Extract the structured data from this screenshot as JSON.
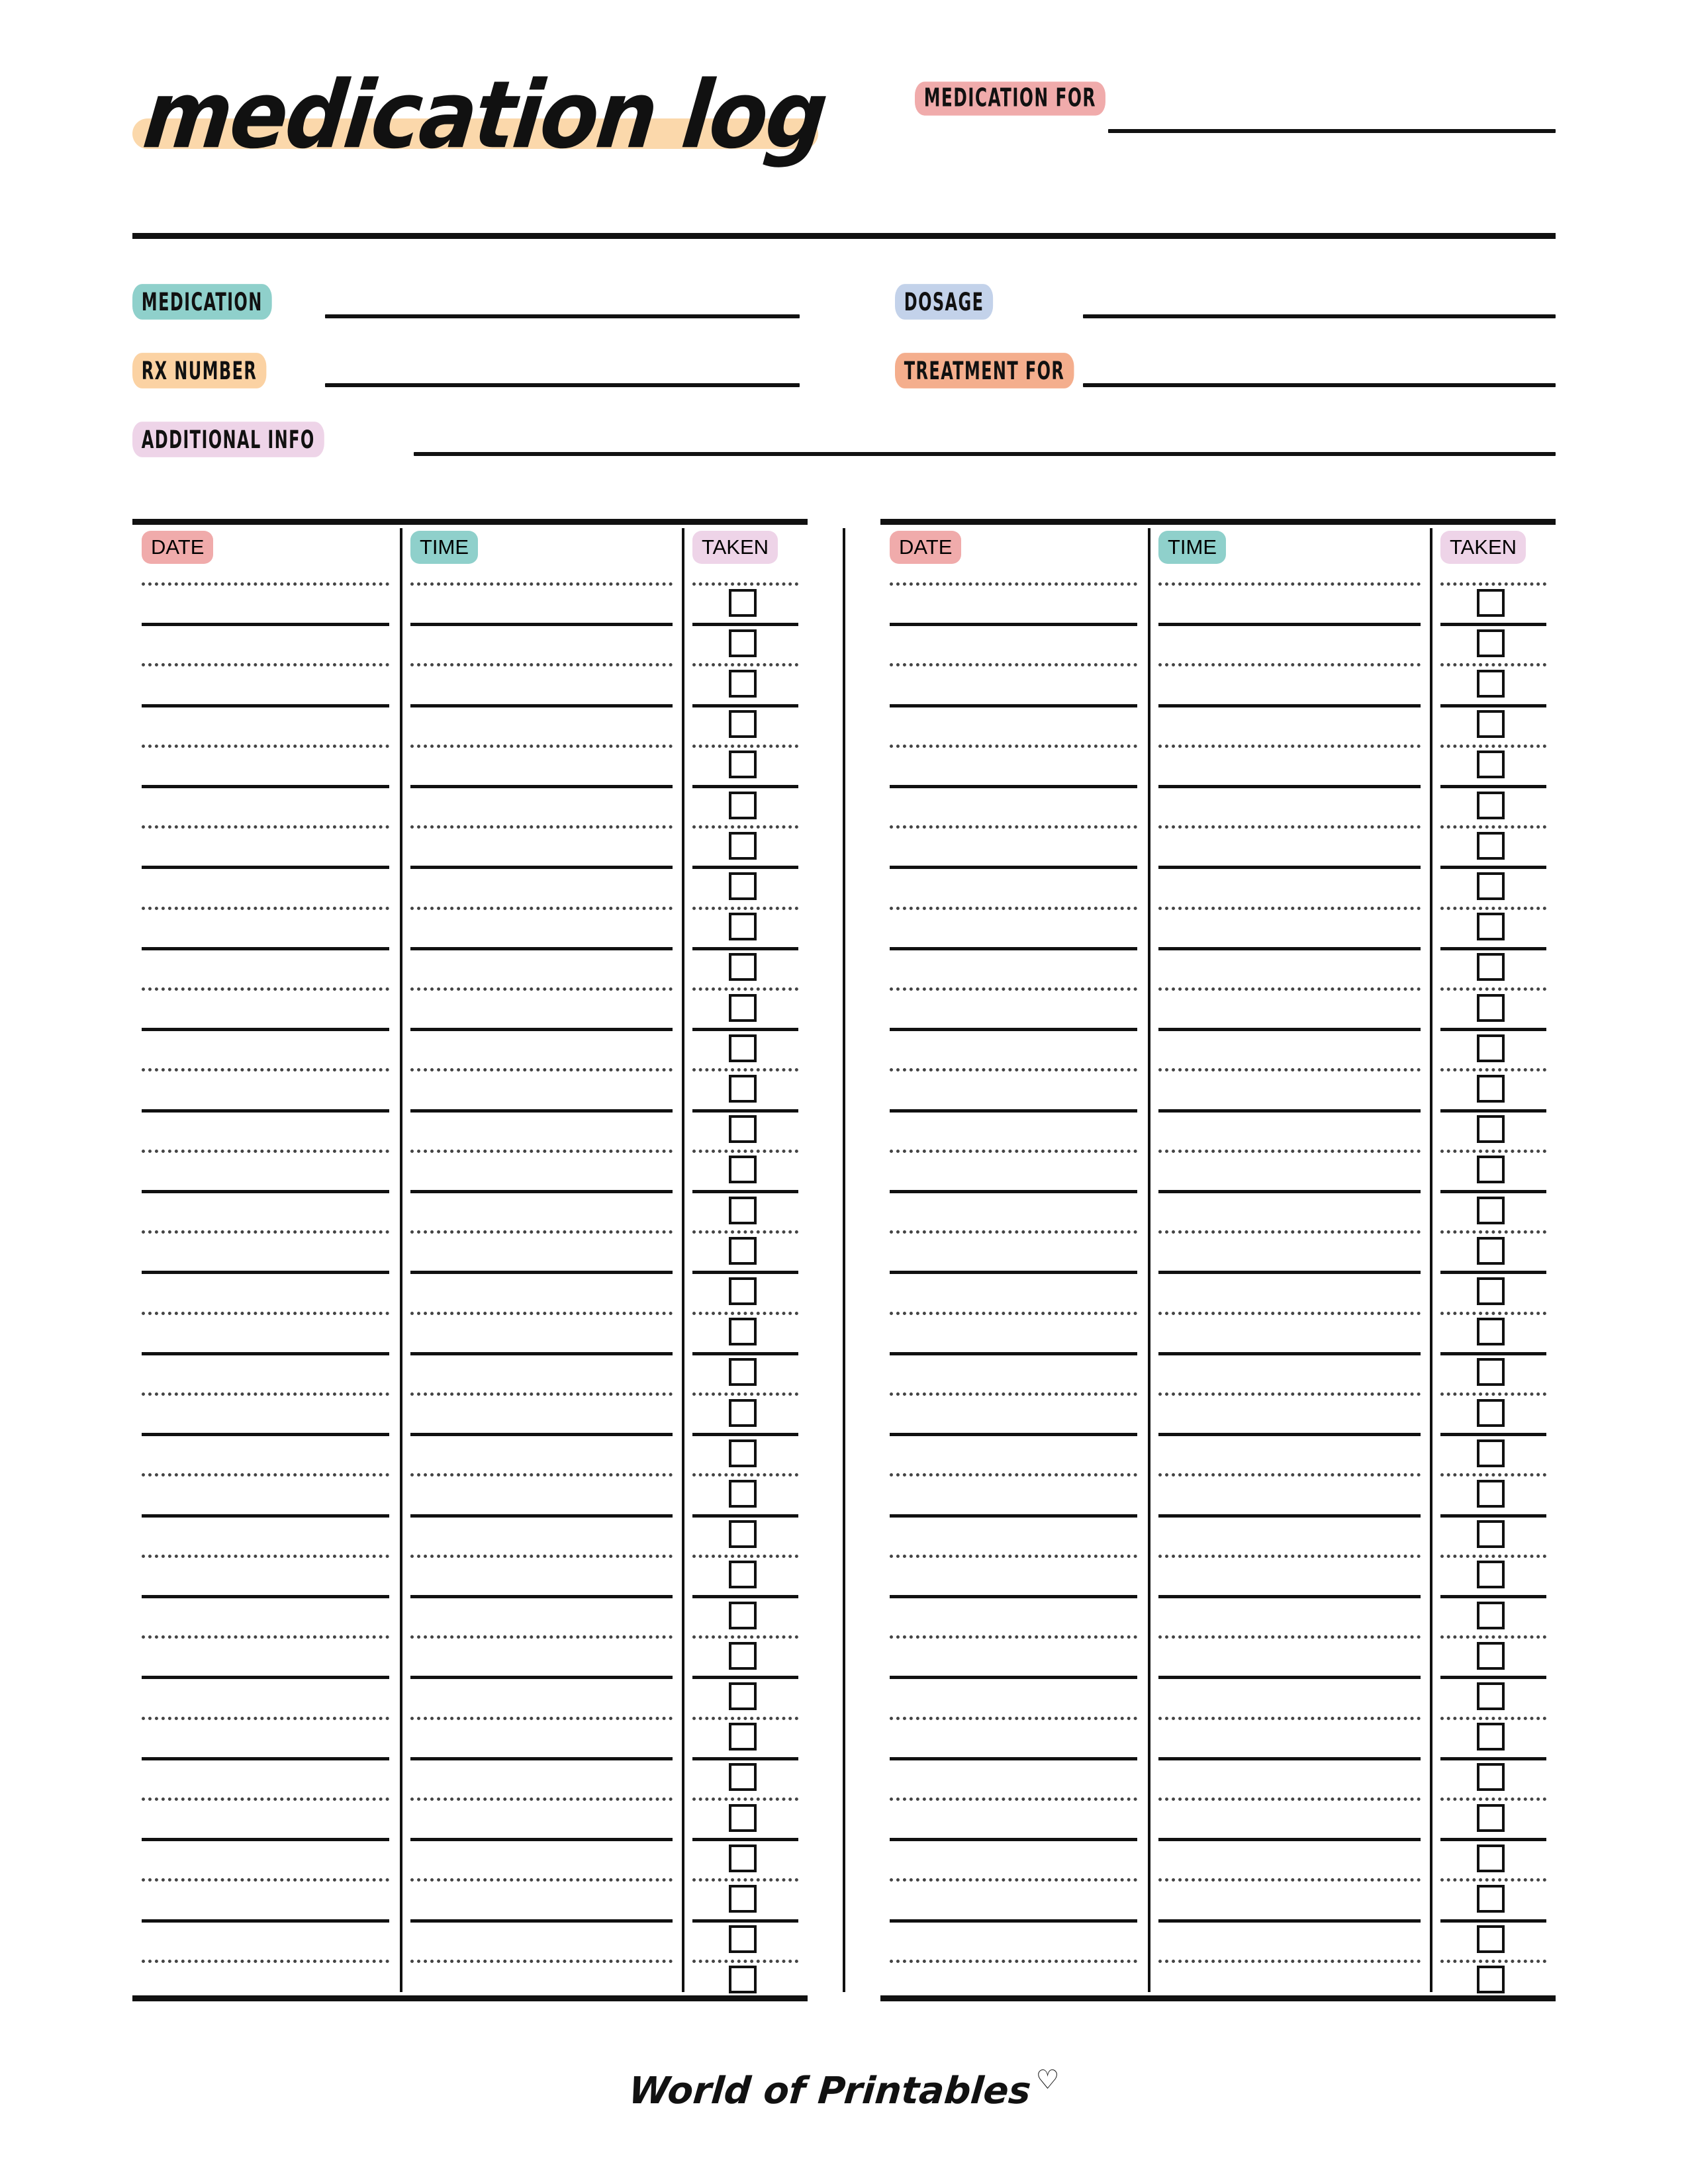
{
  "page": {
    "title": "medication log",
    "background_color": "#ffffff",
    "ink_color": "#111111"
  },
  "header": {
    "title": "medication log",
    "title_highlight_color": "#FBD8AB",
    "medication_for": {
      "label": "MEDICATION FOR",
      "highlight_color": "#F0ABAB",
      "value": ""
    }
  },
  "info_fields": [
    {
      "label": "MEDICATION",
      "highlight_color": "#8FD0CB",
      "value": ""
    },
    {
      "label": "DOSAGE",
      "highlight_color": "#C3D2EA",
      "value": ""
    },
    {
      "label": "RX NUMBER",
      "highlight_color": "#FBD2A3",
      "value": ""
    },
    {
      "label": "TREATMENT FOR",
      "highlight_color": "#F4AE8D",
      "value": ""
    },
    {
      "label": "ADDITIONAL INFO",
      "highlight_color": "#EED4E8",
      "value": ""
    }
  ],
  "tables": [
    {
      "name": "left-log-table",
      "columns": [
        {
          "header": "DATE",
          "highlight_color": "#F0ABAB"
        },
        {
          "header": "TIME",
          "highlight_color": "#8FD0CB"
        },
        {
          "header": "TAKEN",
          "highlight_color": "#EED4E8"
        }
      ],
      "row_count": 35,
      "rows": []
    },
    {
      "name": "right-log-table",
      "columns": [
        {
          "header": "DATE",
          "highlight_color": "#F0ABAB"
        },
        {
          "header": "TIME",
          "highlight_color": "#8FD0CB"
        },
        {
          "header": "TAKEN",
          "highlight_color": "#EED4E8"
        }
      ],
      "row_count": 35,
      "rows": []
    }
  ],
  "footer": {
    "brand": "World of Printables",
    "heart_icon": "heart-outline-icon",
    "heart_glyph": "♡"
  }
}
